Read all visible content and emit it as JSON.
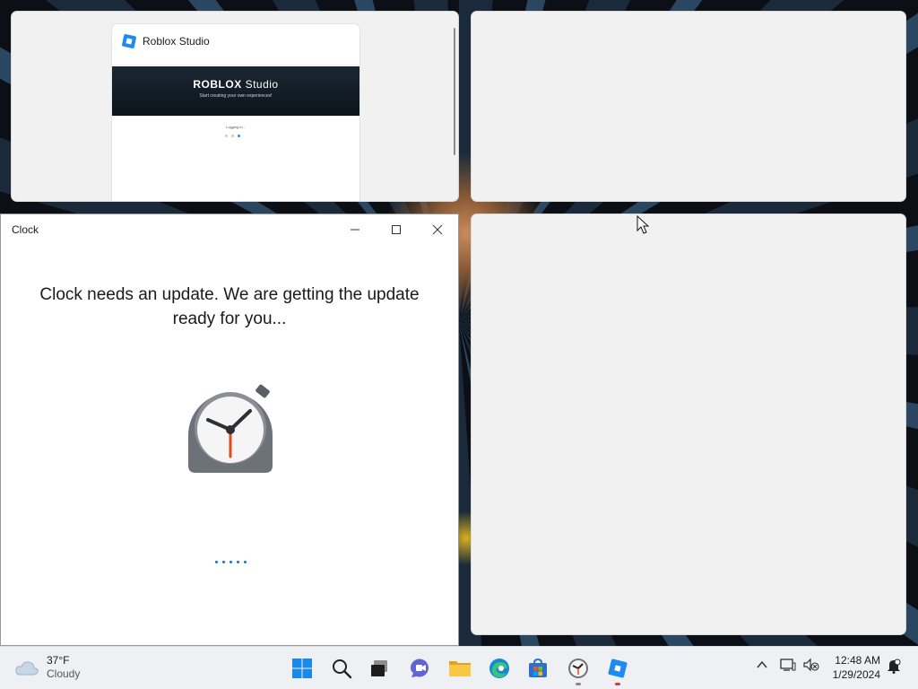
{
  "desktop": {
    "snap_tiles": [
      {
        "app_title": "Roblox Studio"
      }
    ],
    "roblox_thumbnail": {
      "banner_title_bold": "ROBLOX",
      "banner_title_light": " Studio",
      "banner_subtitle": "Start creating your own experiences!",
      "status": "Logging in..."
    }
  },
  "clock_window": {
    "title": "Clock",
    "message": "Clock needs an update. We are getting the update ready for you...",
    "controls": {
      "minimize": "minimize-icon",
      "maximize": "maximize-icon",
      "close": "close-icon"
    }
  },
  "taskbar": {
    "weather": {
      "temperature": "37°F",
      "condition": "Cloudy",
      "icon": "cloud-icon"
    },
    "pinned": [
      {
        "name": "Start",
        "icon": "windows-start-icon"
      },
      {
        "name": "Search",
        "icon": "search-icon"
      },
      {
        "name": "Task View",
        "icon": "task-view-icon"
      },
      {
        "name": "Chat",
        "icon": "chat-icon"
      },
      {
        "name": "File Explorer",
        "icon": "folder-icon"
      },
      {
        "name": "Microsoft Edge",
        "icon": "edge-icon"
      },
      {
        "name": "Microsoft Store",
        "icon": "store-icon"
      },
      {
        "name": "Clock",
        "icon": "clock-icon",
        "running": true
      },
      {
        "name": "Roblox Studio",
        "icon": "roblox-icon",
        "running": true
      }
    ],
    "tray": {
      "time": "12:48 AM",
      "date": "1/29/2024"
    }
  },
  "colors": {
    "accent": "#0067c0",
    "roblox_blue": "#1f8bf0",
    "clock_hand": "#e24a1b"
  }
}
